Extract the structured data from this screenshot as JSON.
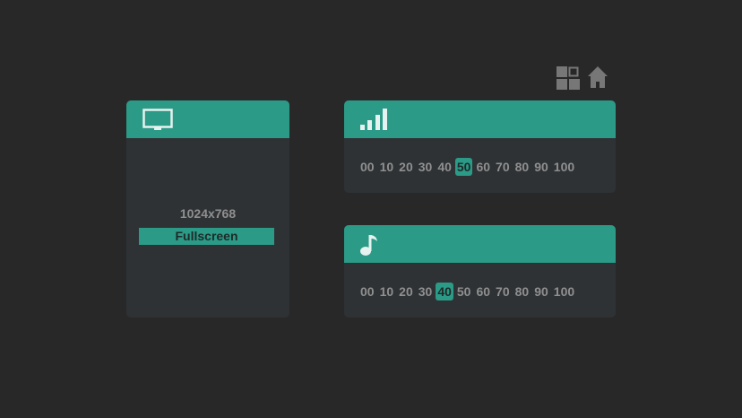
{
  "icons": {
    "grid": "grid-icon",
    "home": "home-icon",
    "display": "monitor-icon",
    "signal": "signal-bars-icon",
    "music": "music-note-icon"
  },
  "colors": {
    "background": "#282828",
    "panel": "#2e3235",
    "accent": "#2b9a87",
    "text_muted": "#8f8f8f"
  },
  "display": {
    "resolution": "1024x768",
    "fullscreen_label": "Fullscreen"
  },
  "signal": {
    "levels": [
      "00",
      "10",
      "20",
      "30",
      "40",
      "50",
      "60",
      "70",
      "80",
      "90",
      "100"
    ],
    "selected": "50"
  },
  "music": {
    "levels": [
      "00",
      "10",
      "20",
      "30",
      "40",
      "50",
      "60",
      "70",
      "80",
      "90",
      "100"
    ],
    "selected": "40"
  }
}
